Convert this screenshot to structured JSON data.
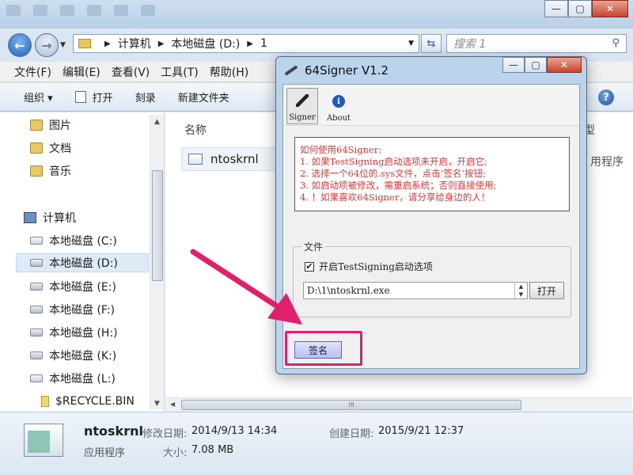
{
  "explorer": {
    "address": {
      "segments": [
        "计算机",
        "本地磁盘 (D:)",
        "1"
      ]
    },
    "search": {
      "placeholder": "搜索 1"
    },
    "menu": [
      "文件(F)",
      "编辑(E)",
      "查看(V)",
      "工具(T)",
      "帮助(H)"
    ],
    "commands": {
      "organize": "组织 ▾",
      "open": "打开",
      "burn": "刻录",
      "new_folder": "新建文件夹"
    },
    "sidebar": [
      {
        "label": "图片",
        "icon": "pictures-icon"
      },
      {
        "label": "文档",
        "icon": "documents-icon"
      },
      {
        "label": "音乐",
        "icon": "music-icon"
      },
      {
        "label": "计算机",
        "icon": "computer-icon"
      },
      {
        "label": "本地磁盘 (C:)",
        "icon": "drive-icon"
      },
      {
        "label": "本地磁盘 (D:)",
        "icon": "drive-icon"
      },
      {
        "label": "本地磁盘 (E:)",
        "icon": "drive-icon"
      },
      {
        "label": "本地磁盘 (F:)",
        "icon": "drive-icon"
      },
      {
        "label": "本地磁盘 (H:)",
        "icon": "drive-icon"
      },
      {
        "label": "本地磁盘 (K:)",
        "icon": "drive-icon"
      },
      {
        "label": "本地磁盘 (L:)",
        "icon": "drive-icon"
      },
      {
        "label": "$RECYCLE.BIN",
        "icon": "folder-icon"
      }
    ],
    "columns": {
      "name": "名称",
      "type_fragment": "型"
    },
    "file": {
      "name": "ntoskrnl",
      "type_fragment": "用程序"
    },
    "details": {
      "name": "ntoskrnl",
      "type": "应用程序",
      "modified_label": "修改日期:",
      "modified": "2014/9/13 14:34",
      "created_label": "创建日期:",
      "created": "2015/9/21 12:37",
      "size_label": "大小:",
      "size": "7.08 MB"
    }
  },
  "dialog": {
    "title": "64Signer V1.2",
    "toolbar": {
      "signer": "Signer",
      "about": "About"
    },
    "howto": [
      "如何使用64Signer:",
      "1. 如果TestSigning启动选项未开启，开启它;",
      "2. 选择一个64位的.sys文件，点击‘签名’按钮;",
      "3. 如启动项被修改，需重启系统；否则直接使用;",
      "4. ！如果喜欢64Signer，请分享给身边的人！"
    ],
    "group_label": "文件",
    "checkbox_label": "开启TestSigning启动选项",
    "checkbox_checked": true,
    "path": "D:\\1\\ntoskrnl.exe",
    "open_label": "打开",
    "sign_label": "签名"
  },
  "colors": {
    "annotation": "#e0206c",
    "howto_text": "#e33333"
  }
}
